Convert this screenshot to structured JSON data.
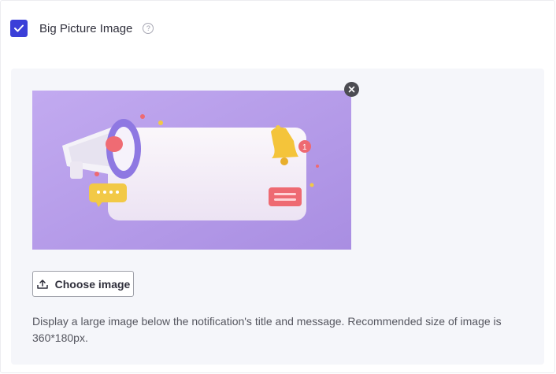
{
  "setting": {
    "label": "Big Picture Image",
    "checked": true,
    "help_icon": "question-circle-icon",
    "help_glyph": "?"
  },
  "image": {
    "description": "promotional illustration",
    "remove_icon": "close-icon"
  },
  "choose_button": {
    "label": "Choose image",
    "icon": "upload-image-icon"
  },
  "help_text": "Display a large image below the notification's title and message. Recommended size of image is 360*180px.",
  "colors": {
    "accent": "#3b3fd8",
    "panel_bg": "#f5f6fa",
    "image_bg": "#b59de8"
  }
}
